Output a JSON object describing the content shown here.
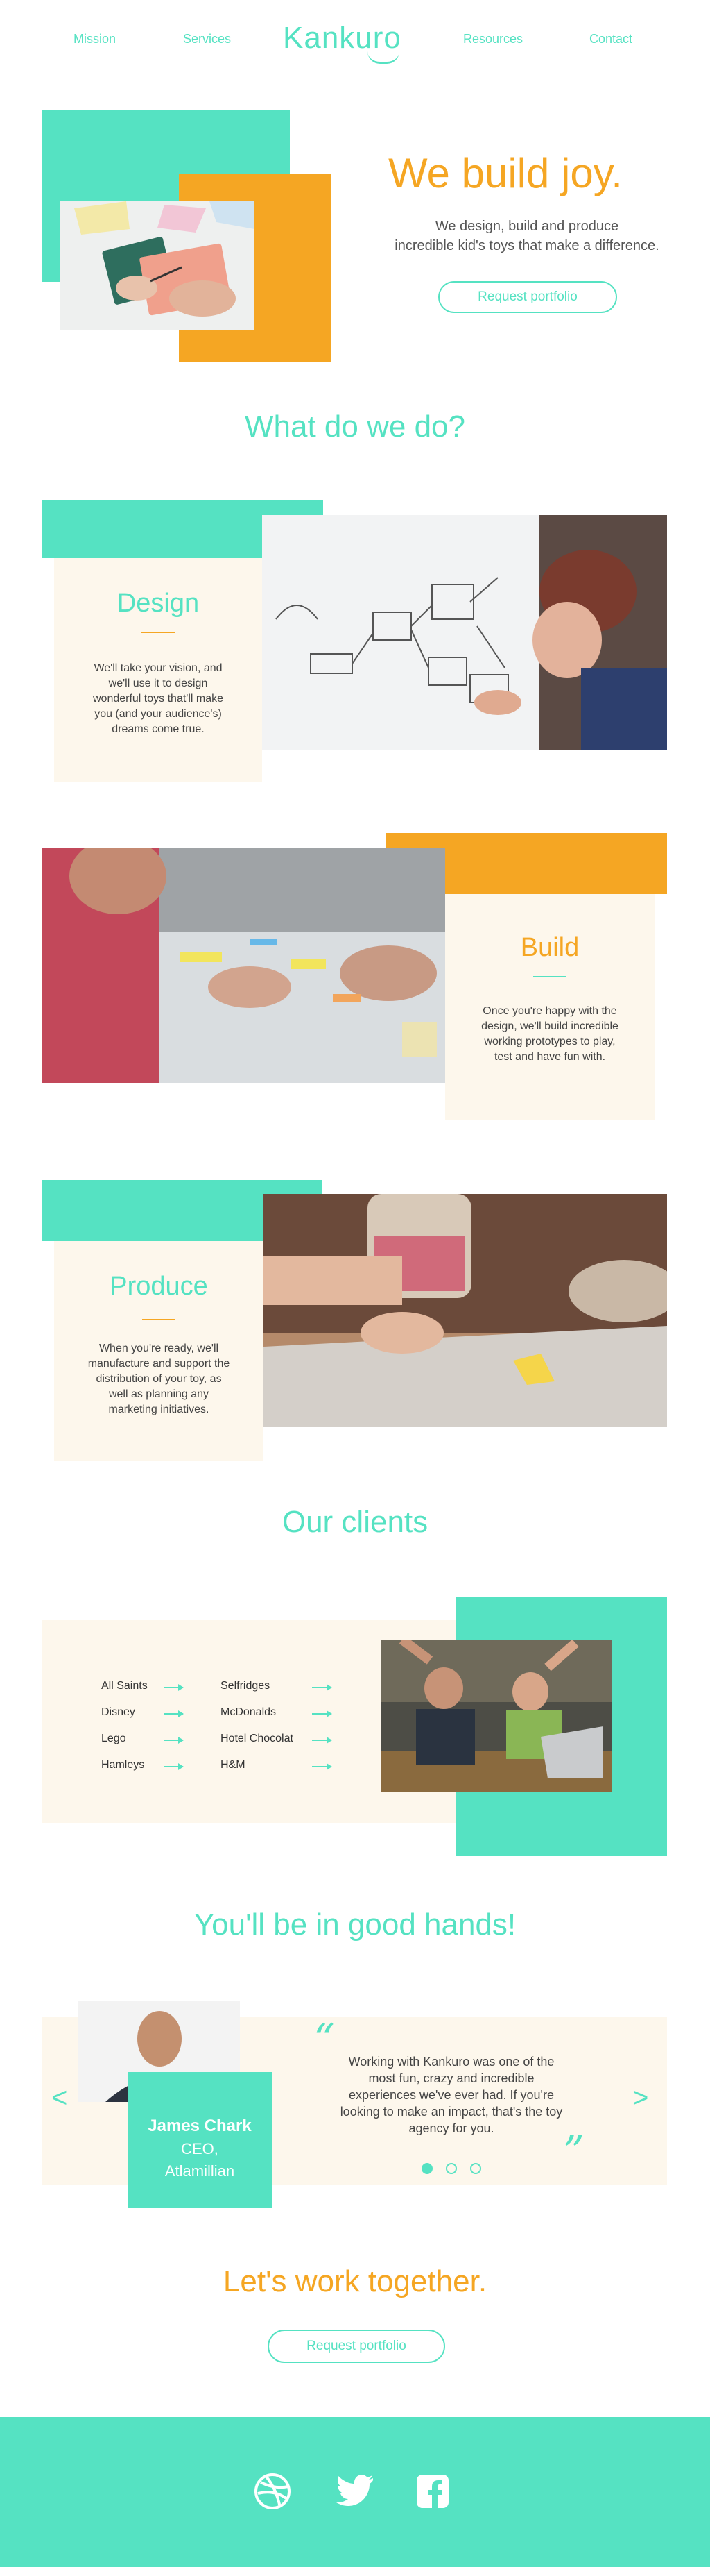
{
  "nav": {
    "mission": "Mission",
    "services": "Services",
    "logo": "Kankuro",
    "resources": "Resources",
    "contact": "Contact"
  },
  "hero": {
    "title": "We build joy.",
    "subtitle_line1": "We design, build and produce",
    "subtitle_line2": "incredible kid's toys that make a difference.",
    "cta": "Request portfolio"
  },
  "services": {
    "title": "What do we do?",
    "items": [
      {
        "title": "Design",
        "text": "We'll take your vision, and we'll use it to design wonderful toys that'll make you (and your audience's) dreams come true."
      },
      {
        "title": "Build",
        "text": "Once you're happy with the design, we'll build incredible working prototypes to play, test and have fun with."
      },
      {
        "title": "Produce",
        "text": "When you're ready, we'll manufacture and support the distribution of your toy, as well as planning any marketing initiatives."
      }
    ]
  },
  "clients": {
    "title": "Our clients",
    "col1": [
      "All Saints",
      "Disney",
      "Lego",
      "Hamleys"
    ],
    "col2": [
      "Selfridges",
      "McDonalds",
      "Hotel Chocolat",
      "H&M"
    ]
  },
  "testimonial": {
    "title": "You'll be in good hands!",
    "name": "James Chark",
    "role": "CEO,",
    "company": "Atlamillian",
    "quote": "Working with Kankuro was one of the most fun, crazy and incredible experiences we've ever had. If you're looking to make an impact, that's the toy agency for you.",
    "open_quote": "“",
    "close_quote": "”",
    "prev": "<",
    "next": ">"
  },
  "cta": {
    "title": "Let's work together.",
    "button": "Request portfolio"
  },
  "footer": {
    "icons": [
      "dribbble-icon",
      "twitter-icon",
      "facebook-icon"
    ]
  },
  "colors": {
    "teal": "#55e2c2",
    "orange": "#f5a623",
    "cream": "#fdf7ec"
  }
}
